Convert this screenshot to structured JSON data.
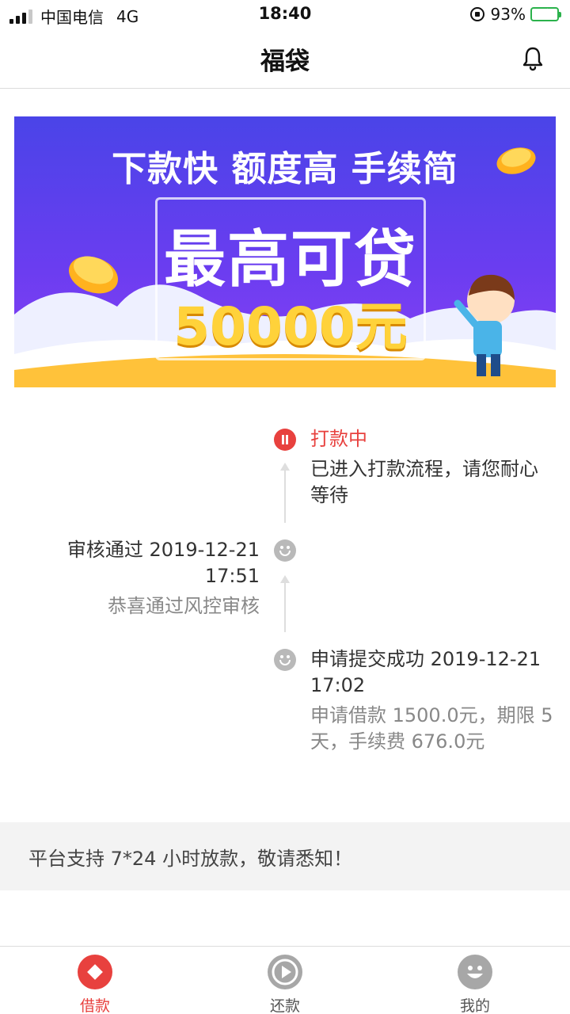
{
  "status_bar": {
    "carrier": "中国电信",
    "network": "4G",
    "time": "18:40",
    "battery": "93%"
  },
  "nav": {
    "title": "福袋",
    "icon": "bell-icon"
  },
  "banner": {
    "tagline": "下款快 额度高 手续简",
    "headline": "最高可贷",
    "amount": "50000元"
  },
  "timeline": {
    "current": {
      "title": "打款中",
      "desc_line1": "已进入打款流程，请您耐心",
      "desc_line2": "等待",
      "icon": "pause-icon"
    },
    "review": {
      "title_line1": "审核通过 2019-12-21",
      "title_line2": "17:51",
      "desc": "恭喜通过风控审核",
      "icon": "smile-icon"
    },
    "submitted": {
      "title_line1": "申请提交成功 2019-12-21",
      "title_line2": "17:02",
      "desc_line1": "申请借款 1500.0元，期限 5",
      "desc_line2": "天，手续费 676.0元",
      "icon": "smile-icon"
    }
  },
  "notice": "平台支持 7*24 小时放款，敬请悉知！",
  "tabs": [
    {
      "label": "借款",
      "icon": "diamond-icon",
      "active": true
    },
    {
      "label": "还款",
      "icon": "play-icon",
      "active": false
    },
    {
      "label": "我的",
      "icon": "smile-icon",
      "active": false
    }
  ],
  "colors": {
    "accent": "#e8413e",
    "inactive": "#a7a7a7",
    "banner_top": "#4a44e8",
    "banner_bottom": "#8b3ff5"
  }
}
